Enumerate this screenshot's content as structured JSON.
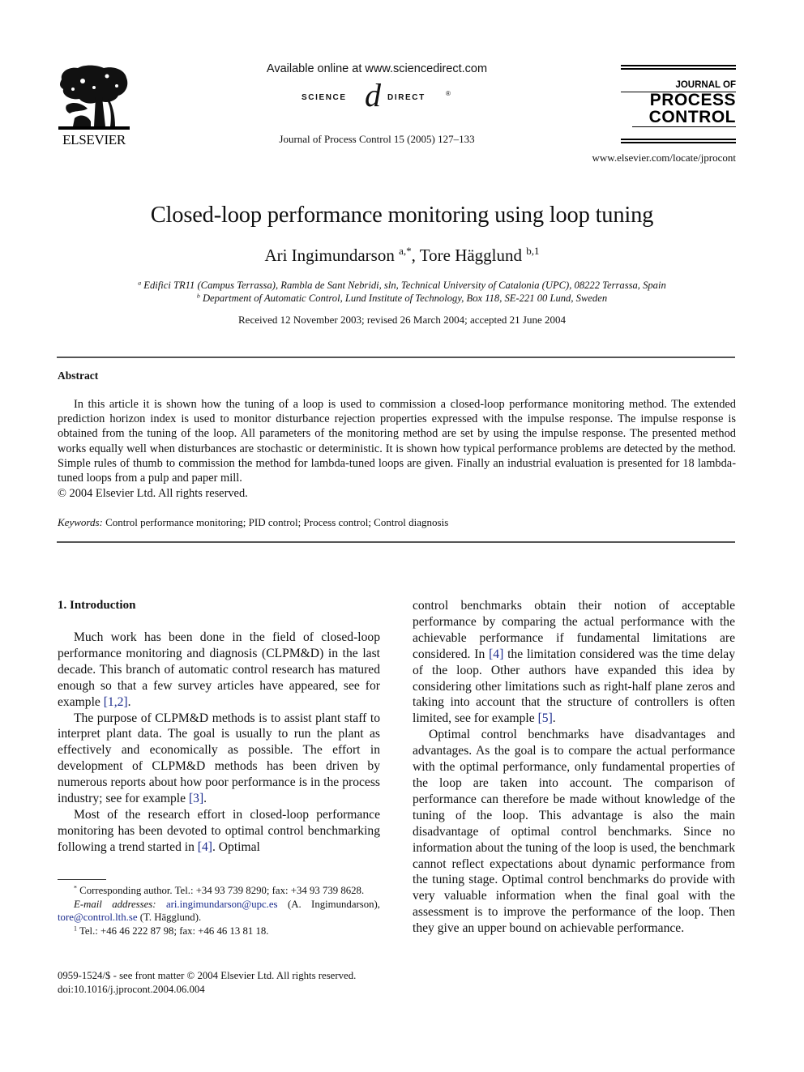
{
  "header": {
    "publisher_logo_word": "ELSEVIER",
    "available_online": "Available online at www.sciencedirect.com",
    "sciencedirect_left": "SCIENCE",
    "sciencedirect_at": "d",
    "sciencedirect_right": "DIRECT",
    "sciencedirect_reg": "®",
    "journal_citation": "Journal of Process Control 15 (2005) 127–133",
    "journal_logo": {
      "line1": "JOURNAL OF",
      "line2": "PROCESS",
      "line3": "CONTROL"
    },
    "journal_url": "www.elsevier.com/locate/jprocont"
  },
  "article": {
    "title": "Closed-loop performance monitoring using loop tuning",
    "authors": [
      {
        "name": "Ari Ingimundarson",
        "marks": "a,*"
      },
      {
        "name": "Tore Hägglund",
        "marks": "b,1"
      }
    ],
    "author_separator": ", ",
    "affiliations": [
      {
        "mark": "a",
        "text": "Edifici TR11 (Campus Terrassa), Rambla de Sant Nebridi, sln, Technical University of Catalonia (UPC), 08222 Terrassa, Spain"
      },
      {
        "mark": "b",
        "text": "Department of Automatic Control, Lund Institute of Technology, Box 118, SE-221 00 Lund, Sweden"
      }
    ],
    "received": "Received 12 November 2003; revised 26 March 2004; accepted 21 June 2004"
  },
  "abstract": {
    "heading": "Abstract",
    "body": "In this article it is shown how the tuning of a loop is used to commission a closed-loop performance monitoring method. The extended prediction horizon index is used to monitor disturbance rejection properties expressed with the impulse response. The impulse response is obtained from the tuning of the loop. All parameters of the monitoring method are set by using the impulse response. The presented method works equally well when disturbances are stochastic or deterministic. It is shown how typical performance problems are detected by the method. Simple rules of thumb to commission the method for lambda-tuned loops are given. Finally an industrial evaluation is presented for 18 lambda-tuned loops from a pulp and paper mill.",
    "copyright": "© 2004 Elsevier Ltd. All rights reserved.",
    "keywords_label": "Keywords:",
    "keywords": "Control performance monitoring; PID control; Process control; Control diagnosis"
  },
  "section1": {
    "heading": "1. Introduction",
    "left_paragraphs": [
      {
        "before": "Much work has been done in the field of closed-loop performance monitoring and diagnosis (CLPM&D) in the last decade. This branch of automatic control research has matured enough so that a few survey articles have appeared, see for example ",
        "ref": "[1,2]",
        "after": "."
      },
      {
        "before": "The purpose of CLPM&D methods is to assist plant staff to interpret plant data. The goal is usually to run the plant as effectively and economically as possible. The effort in development of CLPM&D methods has been driven by numerous reports about how poor performance is in the process industry; see for example ",
        "ref": "[3]",
        "after": "."
      },
      {
        "before": "Most of the research effort in closed-loop performance monitoring has been devoted to optimal control benchmarking following a trend started in ",
        "ref": "[4]",
        "after": ". Optimal"
      }
    ],
    "right_paragraphs": [
      {
        "parts": [
          "control benchmarks obtain their notion of acceptable performance by comparing the actual performance with the achievable performance if fundamental limitations are considered. In ",
          "[4]",
          " the limitation considered was the time delay of the loop. Other authors have expanded this idea by considering other limitations such as right-half plane zeros and taking into account that the structure of controllers is often limited, see for example ",
          "[5]",
          "."
        ]
      },
      {
        "text": "Optimal control benchmarks have disadvantages and advantages. As the goal is to compare the actual performance with the optimal performance, only fundamental properties of the loop are taken into account. The comparison of performance can therefore be made without knowledge of the tuning of the loop. This advantage is also the main disadvantage of optimal control benchmarks. Since no information about the tuning of the loop is used, the benchmark cannot reflect expectations about dynamic performance from the tuning stage. Optimal control benchmarks do provide with very valuable information when the final goal with the assessment is to improve the performance of the loop. Then they give an upper bound on achievable performance."
      }
    ]
  },
  "footnotes": {
    "corresponding_mark": "*",
    "corresponding": "Corresponding author. Tel.: +34 93 739 8290; fax: +34 93 739 8628.",
    "email_label": "E-mail addresses:",
    "email1": "ari.ingimundarson@upc.es",
    "email1_owner": " (A. Ingimundarson),",
    "email2": "tore@control.lth.se",
    "email2_owner": " (T. Hägglund).",
    "note1_mark": "1",
    "note1": "Tel.: +46 46 222 87 98; fax: +46 46 13 81 18."
  },
  "front_matter": {
    "issn": "0959-1524/$ - see front matter  © 2004 Elsevier Ltd. All rights reserved.",
    "doi": "doi:10.1016/j.jprocont.2004.06.004"
  },
  "colors": {
    "link": "#1a2b8c",
    "text": "#111111",
    "rule": "#555555"
  }
}
